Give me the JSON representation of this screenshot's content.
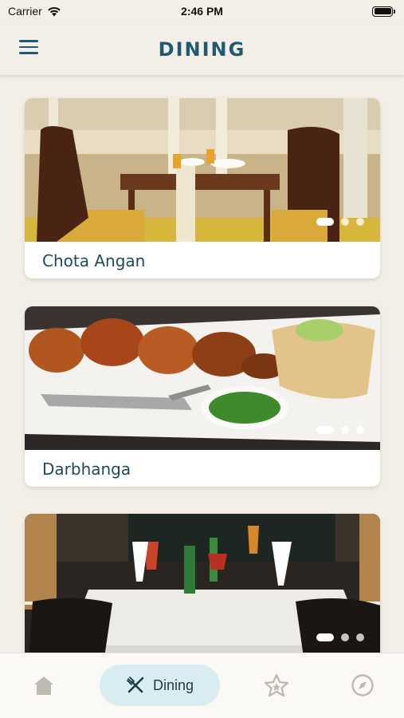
{
  "status_bar": {
    "carrier": "Carrier",
    "time": "2:46 PM"
  },
  "header": {
    "title": "DINING",
    "menu_icon": "hamburger-menu-icon"
  },
  "restaurants": [
    {
      "name": "Chota Angan",
      "image": "ornate-dining-room",
      "slide_count": 3,
      "active_slide": 1
    },
    {
      "name": "Darbhanga",
      "image": "tandoori-platter",
      "slide_count": 3,
      "active_slide": 1
    },
    {
      "name": "",
      "image": "terrace-table-setting",
      "slide_count": 3,
      "active_slide": 1
    }
  ],
  "bottom_nav": {
    "items": [
      {
        "icon": "home-icon",
        "label": ""
      },
      {
        "icon": "fork-knife-icon",
        "label": "Dining",
        "active": true
      },
      {
        "icon": "star-icon",
        "label": ""
      },
      {
        "icon": "compass-icon",
        "label": ""
      }
    ]
  },
  "colors": {
    "background": "#f3efe7",
    "accent": "#1f5a72",
    "active_nav_bg": "#d8ecf1"
  }
}
